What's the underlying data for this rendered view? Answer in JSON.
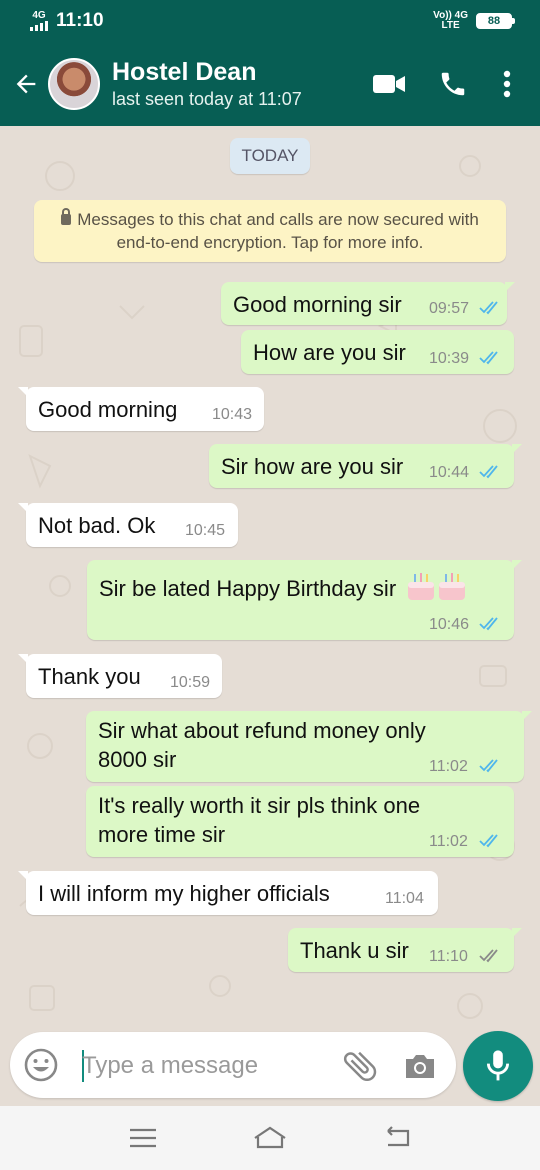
{
  "status_bar": {
    "network": "4G",
    "time": "11:10",
    "volte": "Vo)) 4G",
    "lte": "LTE",
    "battery": "88"
  },
  "header": {
    "contact_name": "Hostel Dean",
    "last_seen": "last seen today at 11:07",
    "icons": [
      "back-arrow-icon",
      "video-call-icon",
      "phone-icon",
      "more-vert-icon"
    ]
  },
  "chat": {
    "date_chip": "TODAY",
    "encryption_notice": "Messages to this chat and calls are now secured with end-to-end encryption. Tap for more info.",
    "messages": [
      {
        "dir": "out",
        "text": "Good morning sir",
        "time": "09:57",
        "status": "read"
      },
      {
        "dir": "out",
        "text": "How are you sir",
        "time": "10:39",
        "status": "read"
      },
      {
        "dir": "in",
        "text": "Good morning",
        "time": "10:43"
      },
      {
        "dir": "out",
        "text": "Sir how are you sir",
        "time": "10:44",
        "status": "read"
      },
      {
        "dir": "in",
        "text": "Not bad. Ok",
        "time": "10:45"
      },
      {
        "dir": "out",
        "text": "Sir be lated Happy Birthday sir",
        "time": "10:46",
        "status": "read",
        "emoji": "cake"
      },
      {
        "dir": "in",
        "text": "Thank you",
        "time": "10:59"
      },
      {
        "dir": "out",
        "text": "Sir what about refund money only 8000 sir",
        "line1": "Sir what about refund money only",
        "line2": "8000 sir",
        "time": "11:02",
        "status": "read"
      },
      {
        "dir": "out",
        "text": "It's really worth it sir pls think one more time sir",
        "line1": "It's really worth it sir pls think one",
        "line2": "more time sir",
        "time": "11:02",
        "status": "read"
      },
      {
        "dir": "in",
        "text": "I will inform my higher officials",
        "time": "11:04"
      },
      {
        "dir": "out",
        "text": "Thank u sir",
        "time": "11:10",
        "status": "delivered"
      }
    ]
  },
  "composer": {
    "placeholder": "Type a message"
  },
  "colors": {
    "header": "#075e54",
    "accent": "#128c7e",
    "outgoing_bubble": "#dcf8c6",
    "incoming_bubble": "#ffffff",
    "chat_bg": "#e5ddd5",
    "read_tick": "#4fb6ec",
    "delivered_tick": "#8a8a8a"
  }
}
